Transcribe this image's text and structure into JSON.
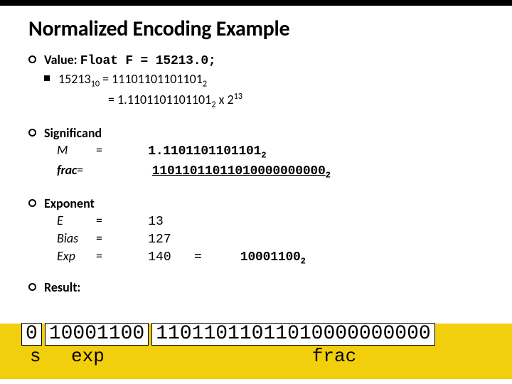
{
  "title": "Normalized Encoding Example",
  "value": {
    "heading": "Value: ",
    "code": "Float F = 15213.0;",
    "line1_left": "15213",
    "line1_sub": "10",
    "line1_eq": " = 11101101101101",
    "line1_sub2": "2",
    "line2_eq": "= 1.1101101101101",
    "line2_sub": "2",
    "line2_mul": " x 2",
    "line2_sup": "13"
  },
  "significand": {
    "heading": "Significand",
    "m_lbl": "M",
    "m_eq": "=",
    "m_val": "1.1101101101101",
    "m_sub": "2",
    "frac_lbl": "frac",
    "frac_eq": "=",
    "frac_val_tail": "11011011011010000000000",
    "frac_sub": "2"
  },
  "exponent": {
    "heading": "Exponent",
    "e_lbl": "E",
    "e_val": "13",
    "bias_lbl": "Bias",
    "bias_val": "127",
    "exp_lbl": "Exp",
    "exp_val": "140",
    "exp_bin": "10001100",
    "exp_sub": "2"
  },
  "result": {
    "heading": "Result:",
    "s": "0",
    "exp": "10001100",
    "frac": "11011011011010000000000",
    "lbl_s": "s",
    "lbl_exp": "exp",
    "lbl_frac": "frac"
  }
}
